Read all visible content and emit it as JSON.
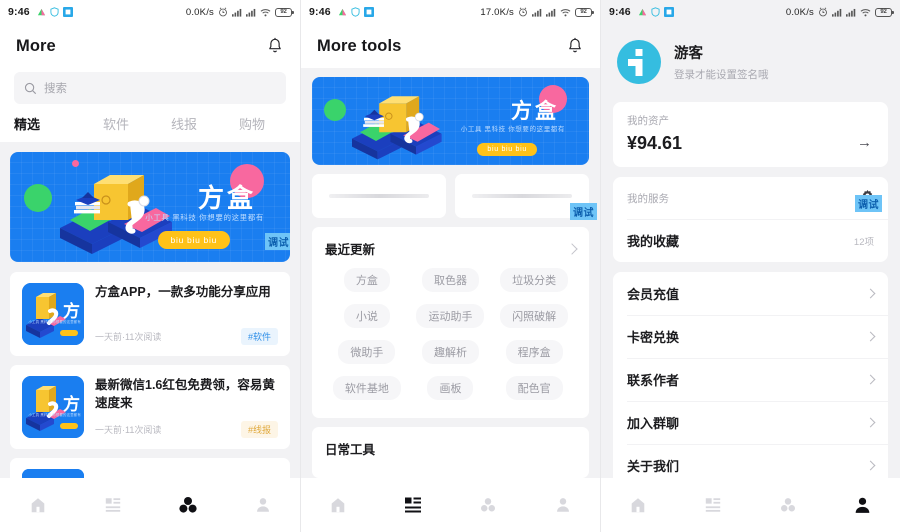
{
  "panels": [
    {
      "statusbar": {
        "time": "9:46",
        "net_speed": "0.0K/s",
        "battery": "92"
      },
      "appbar": {
        "title": "More",
        "bell_icon": "bell-icon"
      },
      "search": {
        "placeholder": "搜索",
        "icon": "search-icon"
      },
      "tabs": [
        {
          "label": "精选",
          "active": true
        },
        {
          "label": "软件",
          "active": false
        },
        {
          "label": "线报",
          "active": false
        },
        {
          "label": "购物",
          "active": false
        }
      ],
      "banner": {
        "title": "方盒",
        "subtitle": "小工具 黑科技 你想要的这里都有",
        "button": "biu biu biu",
        "debug_badge": "调试"
      },
      "articles": [
        {
          "title": "方盒APP，一款多功能分享应用",
          "meta": "一天前·11次阅读",
          "tag": "#软件",
          "tag_style": "blue",
          "thumb_title": "方"
        },
        {
          "title": "最新微信1.6红包免费领，容易黄速度来",
          "meta": "一天前·11次阅读",
          "tag": "#线报",
          "tag_style": "gold",
          "thumb_title": "方"
        }
      ],
      "tabbar": [
        "home-icon",
        "grid-icon",
        "apps-icon",
        "person-icon"
      ],
      "tabbar_active": 2
    },
    {
      "statusbar": {
        "time": "9:46",
        "net_speed": "17.0K/s",
        "battery": "92"
      },
      "appbar": {
        "title": "More tools",
        "bell_icon": "bell-icon"
      },
      "banner": {
        "title": "方盒",
        "subtitle": "小工具 黑科技 你想要的这里都有",
        "button": "biu biu biu",
        "debug_badge": "调试"
      },
      "sections": [
        {
          "title": "最近更新",
          "chips": [
            "方盒",
            "取色器",
            "垃圾分类",
            "小说",
            "运动助手",
            "闪照破解",
            "微助手",
            "趣解析",
            "程序盒",
            "软件基地",
            "画板",
            "配色官"
          ]
        },
        {
          "title": "日常工具",
          "chips": []
        }
      ],
      "tabbar": [
        "home-icon",
        "grid-icon",
        "apps-icon",
        "person-icon"
      ],
      "tabbar_active": 1
    },
    {
      "statusbar": {
        "time": "9:46",
        "net_speed": "0.0K/s",
        "battery": "92"
      },
      "profile": {
        "name": "游客",
        "desc": "登录才能设置签名哦",
        "avatar_icon": "info-avatar-icon"
      },
      "asset": {
        "label": "我的资产",
        "amount": "¥94.61",
        "arrow_icon": "arrow-right-icon"
      },
      "service": {
        "label": "我的服务",
        "gear_icon": "gear-icon",
        "debug_badge": "调试",
        "favorite_label": "我的收藏",
        "favorite_value": "12项"
      },
      "menu": [
        {
          "label": "会员充值"
        },
        {
          "label": "卡密兑换"
        },
        {
          "label": "联系作者"
        },
        {
          "label": "加入群聊"
        },
        {
          "label": "关于我们"
        }
      ],
      "tabbar": [
        "home-icon",
        "grid-icon",
        "apps-icon",
        "person-icon"
      ],
      "tabbar_active": 3
    }
  ],
  "colors": {
    "brand_blue": "#1a7ef0",
    "accent_yellow": "#ffc219",
    "avatar_cyan": "#35bde0",
    "debug_badge_bg": "#6ec4f7",
    "debug_badge_fg": "#0c5fae",
    "page_bg": "#f2f2f4"
  }
}
